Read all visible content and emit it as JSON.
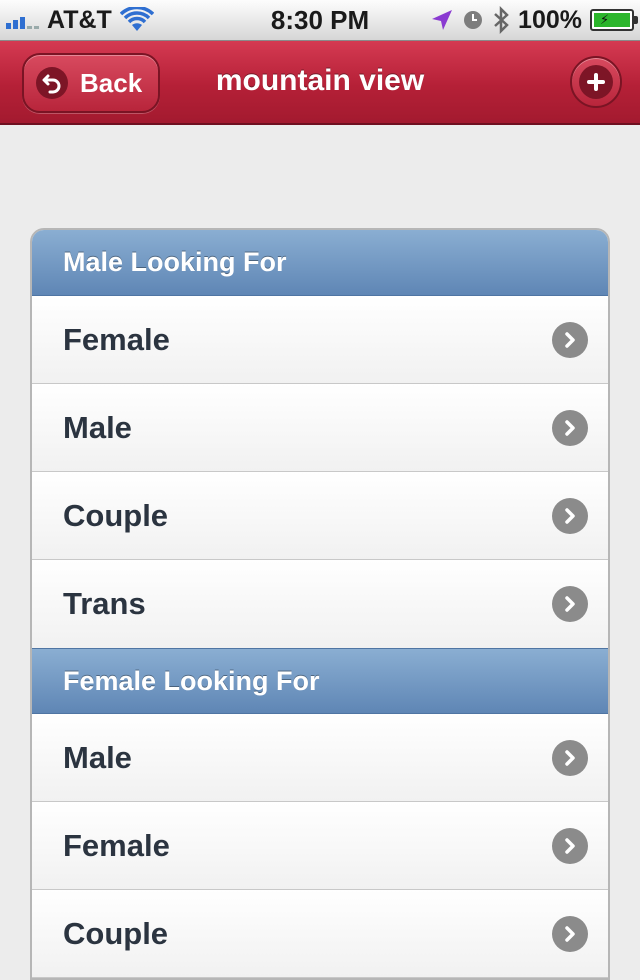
{
  "status_bar": {
    "carrier": "AT&T",
    "time": "8:30 PM",
    "battery": "100%",
    "signal_bars": 3,
    "icons": [
      "signal-icon",
      "wifi-icon",
      "location-arrow-icon",
      "alarm-clock-icon",
      "bluetooth-icon",
      "battery-charging-icon"
    ]
  },
  "nav": {
    "back_label": "Back",
    "title": "mountain view",
    "add_icon": "plus-icon"
  },
  "colors": {
    "nav_bar": "#b52037",
    "section_header": "#6f95c2",
    "row_text": "#2b3440",
    "chevron_bg": "#8b8b8b"
  },
  "sections": [
    {
      "header": "Male Looking For",
      "items": [
        "Female",
        "Male",
        "Couple",
        "Trans"
      ]
    },
    {
      "header": "Female Looking For",
      "items": [
        "Male",
        "Female",
        "Couple"
      ]
    }
  ]
}
